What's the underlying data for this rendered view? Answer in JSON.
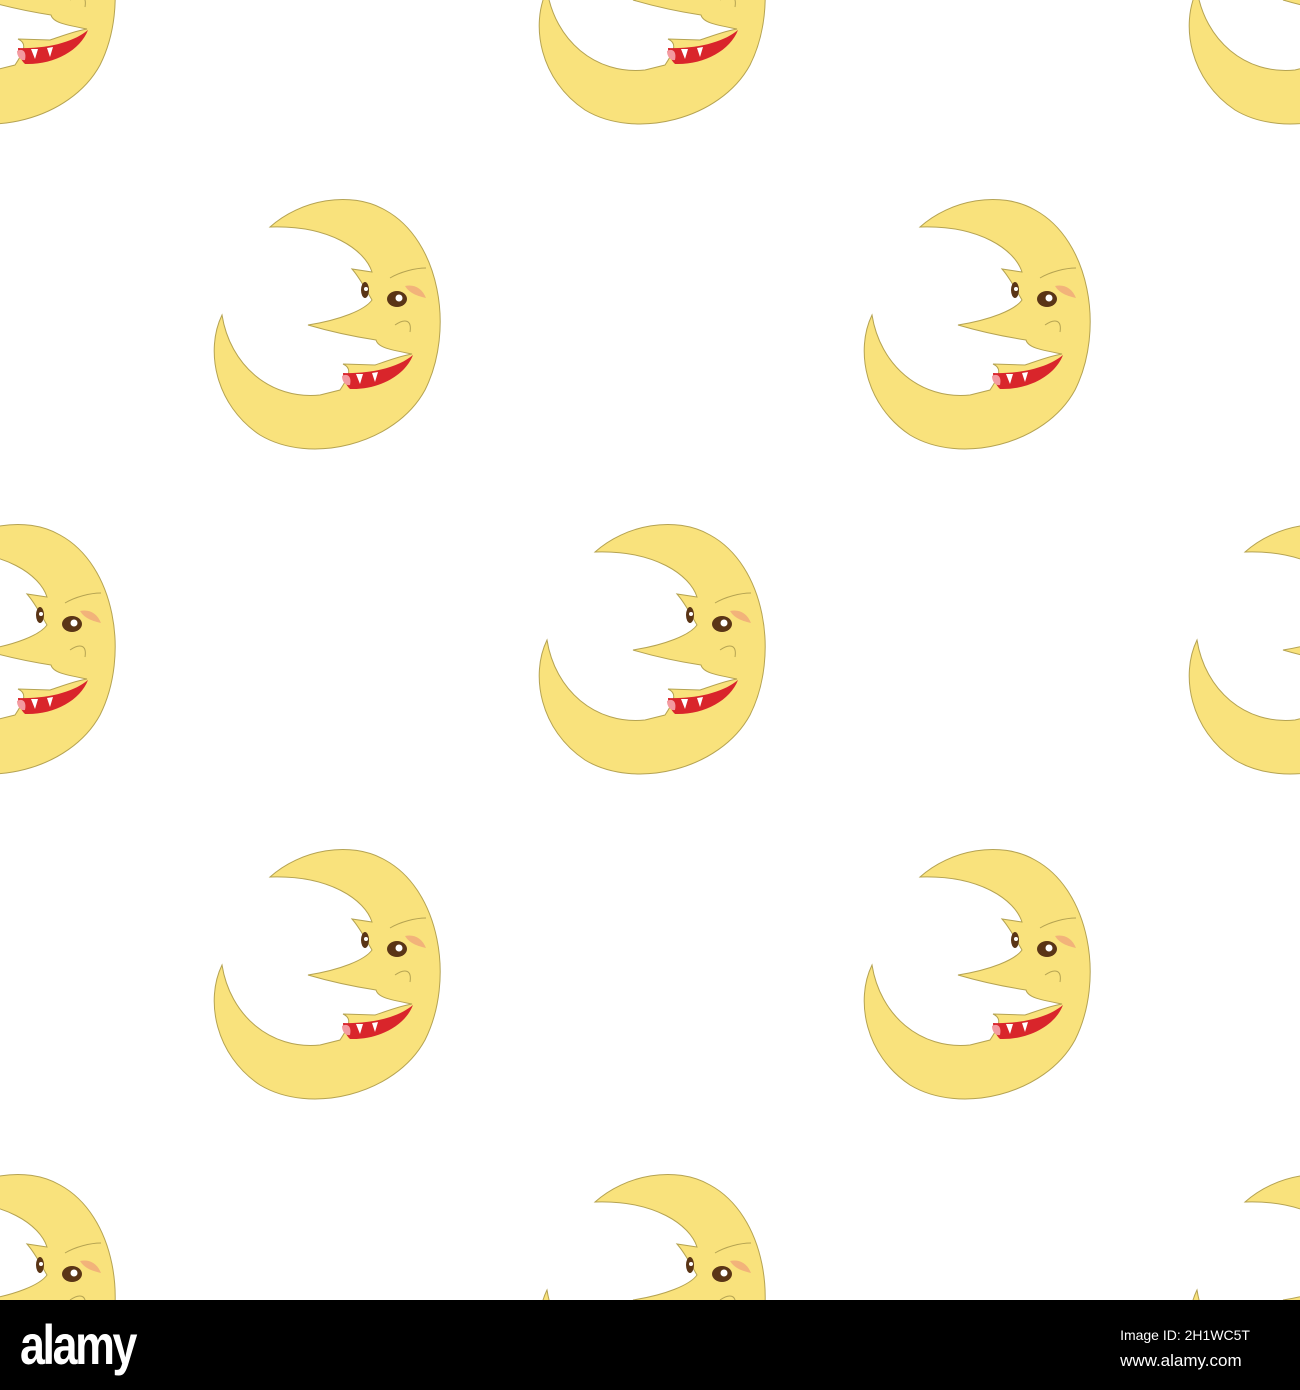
{
  "colors": {
    "moon_fill": "#f9e27c",
    "moon_stroke": "#b5a352",
    "mouth": "#d9252b",
    "eye": "#5a3516",
    "lid": "#f2b37a",
    "footer_bg": "#000000"
  },
  "footer": {
    "logo": "alamy",
    "image_id": "Image ID: 2H1WC5T",
    "url": "www.alamy.com"
  }
}
